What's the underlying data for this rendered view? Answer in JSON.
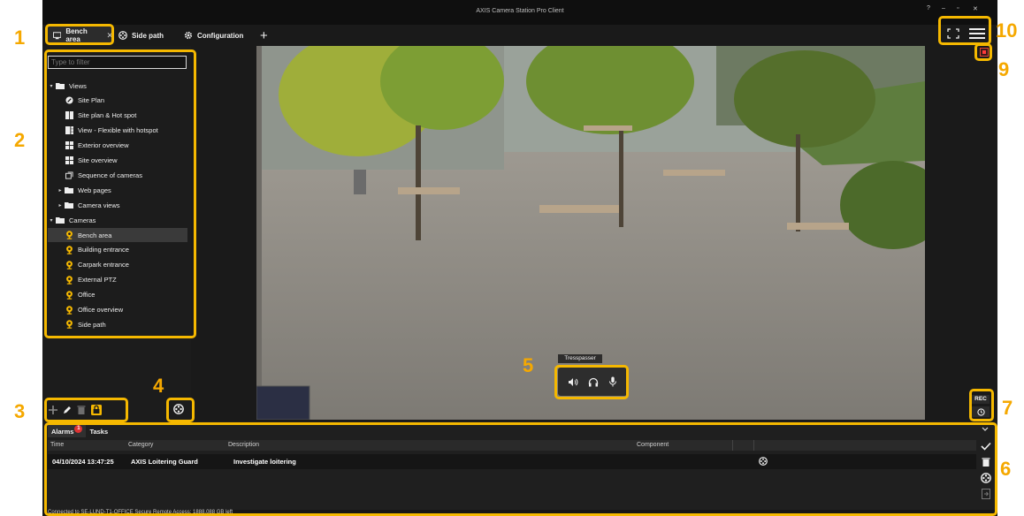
{
  "window": {
    "title": "AXIS Camera Station Pro Client",
    "controls": [
      "?",
      "–",
      "▫",
      "✕"
    ]
  },
  "tabs": [
    {
      "label": "Bench area",
      "icon": "monitor-icon",
      "closable": true,
      "active": true
    },
    {
      "label": "Side path",
      "icon": "camera-reel-icon",
      "closable": false,
      "active": false
    },
    {
      "label": "Configuration",
      "icon": "gear-icon",
      "closable": false,
      "active": false
    }
  ],
  "sidebar": {
    "filter_placeholder": "Type to filter",
    "tree": [
      {
        "label": "Views",
        "icon": "folder-icon",
        "level": 0,
        "expanded": true
      },
      {
        "label": "Site Plan",
        "icon": "map-pin-icon",
        "level": 1
      },
      {
        "label": "Site plan & Hot spot",
        "icon": "split-view-icon",
        "level": 1
      },
      {
        "label": "View - Flexible with hotspot",
        "icon": "flex-view-icon",
        "level": 1
      },
      {
        "label": "Exterior overview",
        "icon": "grid-view-icon",
        "level": 1
      },
      {
        "label": "Site overview",
        "icon": "grid-view-icon",
        "level": 1
      },
      {
        "label": "Sequence of cameras",
        "icon": "sequence-icon",
        "level": 1
      },
      {
        "label": "Web pages",
        "icon": "folder-icon",
        "level": 1,
        "collapsed": true
      },
      {
        "label": "Camera views",
        "icon": "folder-icon",
        "level": 1,
        "collapsed": true
      },
      {
        "label": "Cameras",
        "icon": "folder-icon",
        "level": 0,
        "expanded": true
      },
      {
        "label": "Bench area",
        "icon": "camera-icon",
        "level": 1,
        "selected": true
      },
      {
        "label": "Building entrance",
        "icon": "camera-icon",
        "level": 1
      },
      {
        "label": "Carpark entrance",
        "icon": "camera-icon",
        "level": 1
      },
      {
        "label": "External PTZ",
        "icon": "camera-icon",
        "level": 1
      },
      {
        "label": "Office",
        "icon": "camera-icon",
        "level": 1
      },
      {
        "label": "Office overview",
        "icon": "camera-icon",
        "level": 1
      },
      {
        "label": "Side path",
        "icon": "camera-icon",
        "level": 1
      }
    ],
    "tools": [
      "add-icon",
      "edit-icon",
      "delete-icon",
      "lock-icon"
    ]
  },
  "video": {
    "camera_label": "Tresspasser",
    "controls": [
      "speaker-icon",
      "headphones-icon",
      "microphone-icon"
    ]
  },
  "recording": {
    "rec_label": "REC"
  },
  "bottom": {
    "tabs": [
      {
        "label": "Alarms",
        "badge": "1",
        "active": true
      },
      {
        "label": "Tasks",
        "active": false
      }
    ],
    "columns": [
      "Time",
      "Category",
      "Description",
      "Component"
    ],
    "rows": [
      {
        "time": "04/10/2024 13:47:25",
        "category": "AXIS Loitering Guard",
        "description": "Investigate loitering"
      }
    ],
    "tools": [
      "check-icon",
      "delete-icon",
      "camera-reel-icon",
      "export-icon"
    ]
  },
  "status": "Connected to SE-LUND-T1-OFFICE  Secure Remote Access: 1888.088 GB left",
  "callouts": [
    "1",
    "2",
    "3",
    "4",
    "5",
    "6",
    "7",
    "9",
    "10"
  ],
  "colors": {
    "accent": "#f5b800",
    "callout_text": "#f5a800",
    "app_bg": "#1a1a1a",
    "alert": "#d33333"
  }
}
